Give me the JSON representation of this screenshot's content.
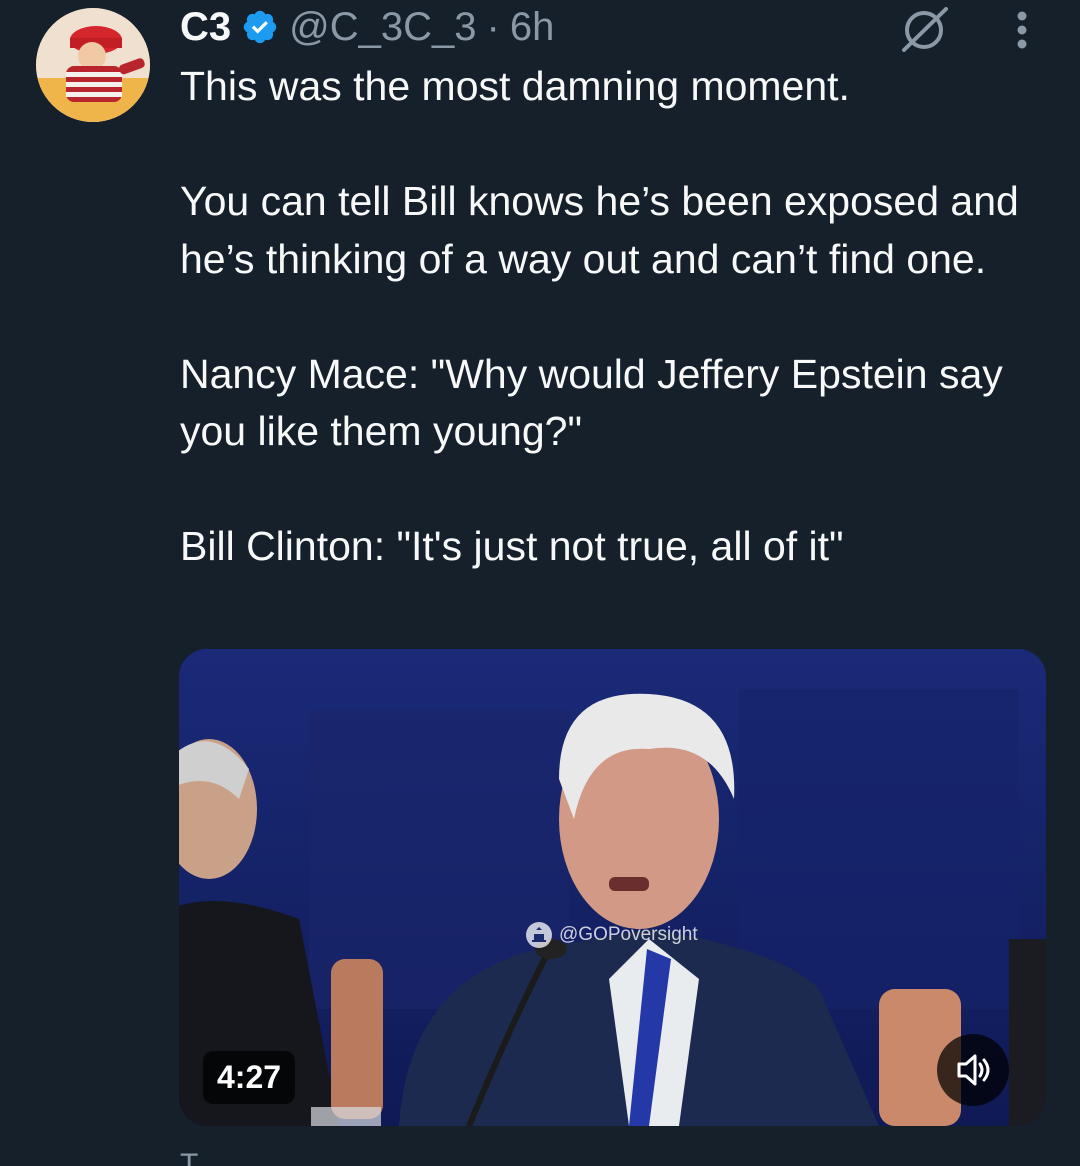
{
  "author": {
    "display_name": "C3",
    "handle": "@C_3C_3",
    "separator": "·",
    "time": "6h",
    "verified": true
  },
  "tweet": {
    "text": "This was the most damning moment.\n\nYou can tell Bill knows he’s been exposed and he’s thinking of a way out and can’t find one.\n\nNancy Mace: \"Why would Jeffery Epstein say you like them young?\"\n\nBill Clinton: \"It's just not true, all of it\""
  },
  "media": {
    "watermark": "@GOPoversight",
    "duration": "4:27"
  },
  "footer": {
    "partial_text": "T"
  },
  "icons": {
    "verified": "verified-badge-icon",
    "grok": "grok-icon",
    "more": "more-options-icon",
    "volume": "volume-icon"
  },
  "colors": {
    "background": "#15202b",
    "text_primary": "#f7f9f9",
    "text_secondary": "#8b98a5",
    "verified_blue": "#1d9bf0"
  }
}
